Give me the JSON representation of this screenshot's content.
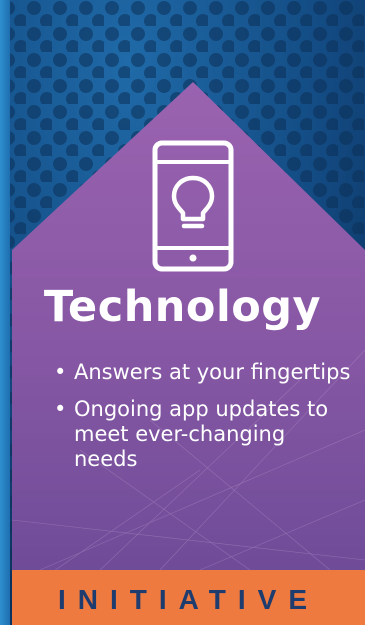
{
  "heading": "Technology",
  "bullets": [
    {
      "text": "Answers at your fingertips"
    },
    {
      "text": "Ongoing app updates to meet ever-changing needs"
    }
  ],
  "banner": {
    "text": "INITIATIVE"
  },
  "icons": {
    "main": "smartphone-lightbulb-icon",
    "bullet": "•"
  },
  "colors": {
    "background_dark": "#0e3f73",
    "background_light": "#2a86c4",
    "panel": "#8e5aa4",
    "banner": "#ee7a40",
    "banner_text": "#1e3c6e",
    "text": "#ffffff"
  }
}
